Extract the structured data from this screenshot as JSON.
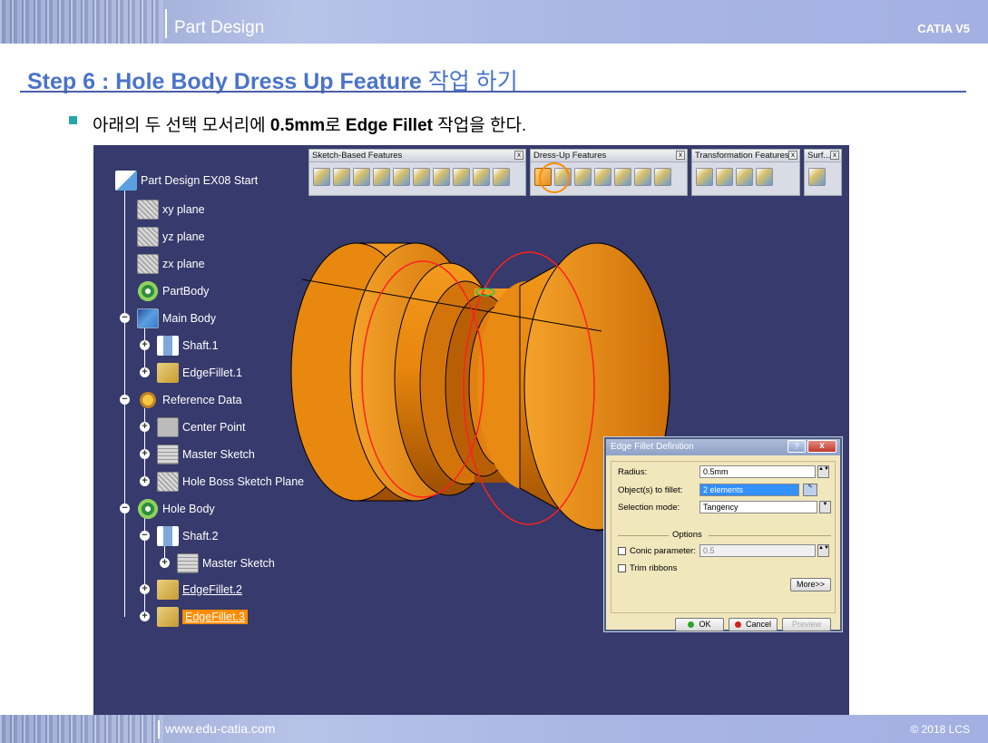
{
  "header": {
    "title": "Part Design",
    "brand": "CATIA V5"
  },
  "step": {
    "title_en": "Step 6 : Hole Body Dress Up Feature",
    "title_kr": "작업 하기"
  },
  "instruction": {
    "pre": "아래의 두 선택 모서리에",
    "value": "0.5mm",
    "mid": "로",
    "cmd": "Edge Fillet",
    "post": "작업을 한다."
  },
  "toolbars": [
    {
      "title": "Sketch-Based Features"
    },
    {
      "title": "Dress-Up Features"
    },
    {
      "title": "Transformation Features"
    },
    {
      "title": "Surf..."
    }
  ],
  "tree": {
    "root": "Part Design EX08 Start",
    "xy": "xy plane",
    "yz": "yz plane",
    "zx": "zx plane",
    "partbody": "PartBody",
    "mainbody": "Main Body",
    "shaft1": "Shaft.1",
    "edgefillet1": "EdgeFillet.1",
    "refdata": "Reference Data",
    "centerpoint": "Center Point",
    "mastersketch1": "Master Sketch",
    "holeboss": "Hole Boss Sketch Plane",
    "holebody": "Hole Body",
    "shaft2": "Shaft.2",
    "mastersketch2": "Master Sketch",
    "edgefillet2": "EdgeFillet.2",
    "edgefillet3": "EdgeFillet.3"
  },
  "dialog": {
    "title": "Edge Fillet Definition",
    "help": "?",
    "close": "x",
    "radius_label": "Radius:",
    "radius_value": "0.5mm",
    "objects_label": "Object(s) to fillet:",
    "objects_value": "2 elements",
    "mode_label": "Selection mode:",
    "mode_value": "Tangency",
    "options_label": "Options",
    "conic_label": "Conic parameter:",
    "conic_value": "0.5",
    "trim_label": "Trim ribbons",
    "more": "More>>",
    "ok": "OK",
    "cancel": "Cancel",
    "preview": "Preview"
  },
  "footer": {
    "url": "www.edu-catia.com",
    "copyright": "© 2018 LCS"
  },
  "colors": {
    "accent": "#4a74c9",
    "viewport": "#363a6c",
    "part": "#e8880e",
    "selection": "#ff8c00"
  }
}
